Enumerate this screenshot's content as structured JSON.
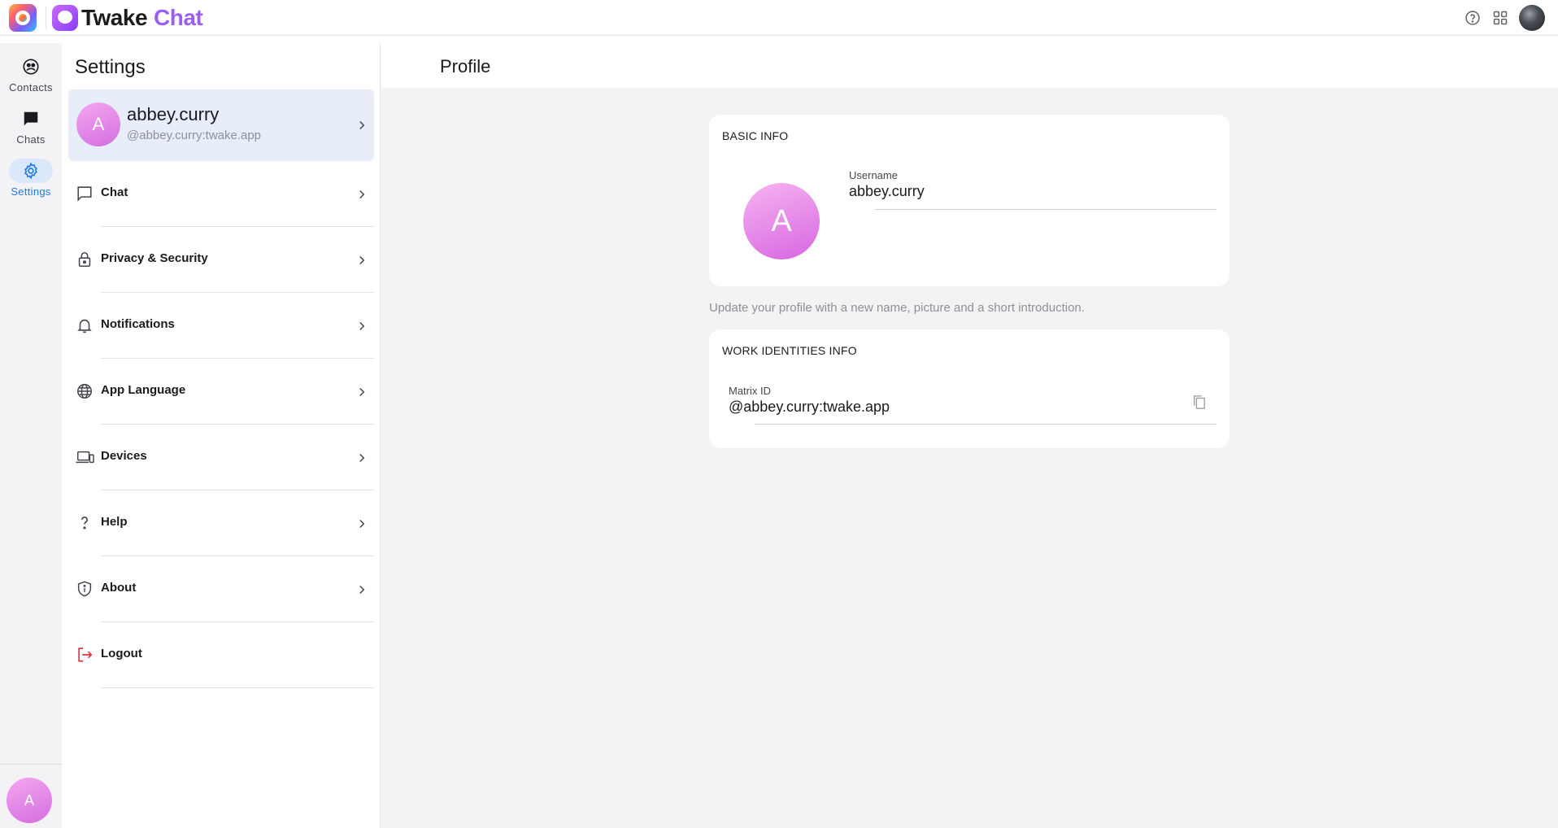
{
  "topbar": {
    "brand_word_1": "Twake",
    "brand_word_2": "Chat",
    "icons": [
      "help-icon",
      "apps-grid-icon"
    ]
  },
  "rail": {
    "items": [
      {
        "label": "Contacts",
        "icon": "contacts-icon",
        "active": false
      },
      {
        "label": "Chats",
        "icon": "chat-bubble-icon",
        "active": false
      },
      {
        "label": "Settings",
        "icon": "gear-icon",
        "active": true
      }
    ],
    "avatar_initial": "A"
  },
  "settings": {
    "title": "Settings",
    "profile": {
      "initial": "A",
      "name": "abbey.curry",
      "matrix_id": "@abbey.curry:twake.app"
    },
    "menu": [
      {
        "label": "Chat",
        "icon": "chat-outline-icon"
      },
      {
        "label": "Privacy & Security",
        "icon": "lock-icon"
      },
      {
        "label": "Notifications",
        "icon": "bell-icon"
      },
      {
        "label": "App Language",
        "icon": "globe-icon"
      },
      {
        "label": "Devices",
        "icon": "devices-icon"
      },
      {
        "label": "Help",
        "icon": "question-icon"
      },
      {
        "label": "About",
        "icon": "shield-info-icon"
      },
      {
        "label": "Logout",
        "icon": "logout-icon"
      }
    ]
  },
  "profile_page": {
    "title": "Profile",
    "basic_info": {
      "heading": "BASIC INFO",
      "avatar_initial": "A",
      "username_label": "Username",
      "username_value": "abbey.curry"
    },
    "hint": "Update your profile with a new name, picture and a short introduction.",
    "work_info": {
      "heading": "WORK IDENTITIES INFO",
      "matrix_label": "Matrix ID",
      "matrix_value": "@abbey.curry:twake.app"
    }
  },
  "colors": {
    "accent": "#1f7ae0",
    "brand_purple": "#9a5ef7",
    "avatar_pink": "#d46ee0",
    "logout_red": "#e0323c",
    "selected_bg": "#e7eef9"
  }
}
